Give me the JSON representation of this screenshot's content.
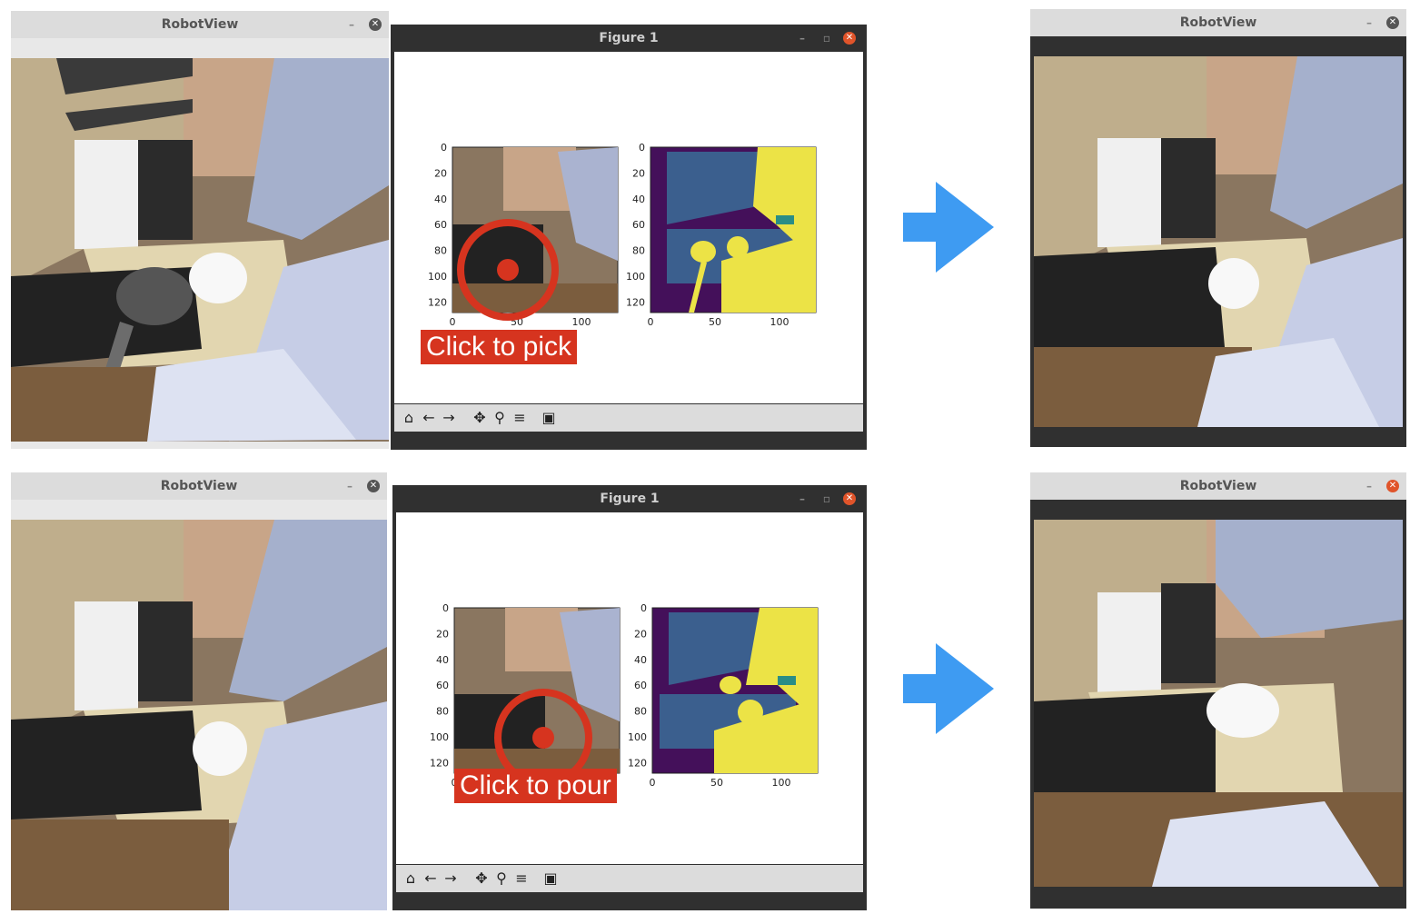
{
  "windows": {
    "robot_title": "RobotView",
    "figure_title": "Figure 1"
  },
  "rows": [
    {
      "action_label": "Click to pick",
      "yticks": [
        "0",
        "20",
        "40",
        "60",
        "80",
        "100",
        "120"
      ],
      "xticks": [
        "0",
        "50",
        "100"
      ]
    },
    {
      "action_label": "Click to pour",
      "yticks": [
        "0",
        "20",
        "40",
        "60",
        "80",
        "100",
        "120"
      ],
      "xticks": [
        "0",
        "50",
        "100"
      ]
    }
  ],
  "toolbar": [
    "home-icon",
    "back-icon",
    "forward-icon",
    "pan-icon",
    "zoom-icon",
    "configure-icon",
    "save-icon"
  ],
  "colors": {
    "arrow": "#3e9bf2",
    "marker": "#d6341f",
    "seg_purple": "#44105a",
    "seg_blue": "#3b5f8e",
    "seg_teal": "#2a8d86",
    "seg_yellow": "#ece346"
  }
}
